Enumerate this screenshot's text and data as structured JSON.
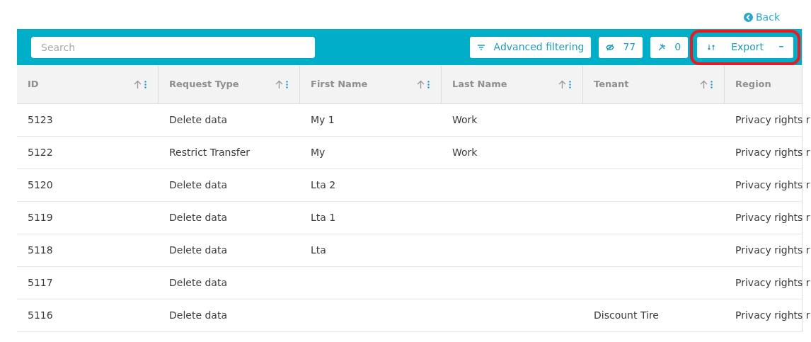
{
  "back_link": {
    "label": "Back"
  },
  "toolbar": {
    "search": {
      "placeholder": "Search"
    },
    "buttons": [
      {
        "kind": "filter",
        "label": "Advanced filtering"
      },
      {
        "kind": "hidden",
        "label": "77"
      },
      {
        "kind": "pin",
        "label": "0"
      },
      {
        "kind": "export",
        "label": "Export",
        "highlighted": true
      }
    ]
  },
  "table": {
    "columns": [
      {
        "label": "ID",
        "sortable": true
      },
      {
        "label": "Request Type",
        "sortable": true
      },
      {
        "label": "First Name",
        "sortable": true
      },
      {
        "label": "Last Name",
        "sortable": true
      },
      {
        "label": "Tenant",
        "sortable": true
      },
      {
        "label": "Region",
        "sortable": false
      }
    ],
    "rows": [
      [
        "5123",
        "Delete data",
        "My 1",
        "Work",
        "",
        "Privacy rights r"
      ],
      [
        "5122",
        "Restrict Transfer",
        "My",
        "Work",
        "",
        "Privacy rights r"
      ],
      [
        "5120",
        "Delete data",
        "Lta 2",
        "",
        "",
        "Privacy rights r"
      ],
      [
        "5119",
        "Delete data",
        "Lta 1",
        "",
        "",
        "Privacy rights r"
      ],
      [
        "5118",
        "Delete data",
        "Lta",
        "",
        "",
        "Privacy rights r"
      ],
      [
        "5117",
        "Delete data",
        "",
        "",
        "",
        "Privacy rights r"
      ],
      [
        "5116",
        "Delete data",
        "",
        "",
        "Discount Tire",
        "Privacy rights r"
      ]
    ]
  }
}
